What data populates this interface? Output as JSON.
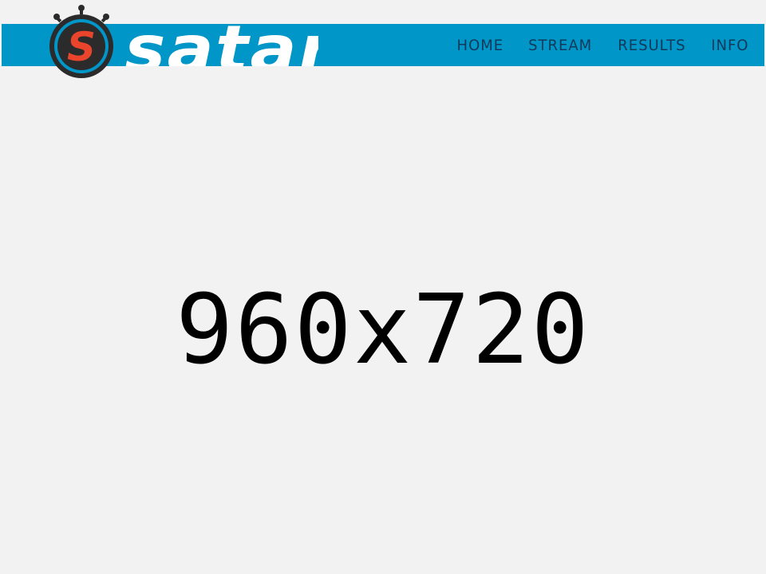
{
  "header": {
    "brand": "satar",
    "logo_letter": "S",
    "nav": [
      {
        "label": "HOME"
      },
      {
        "label": "STREAM"
      },
      {
        "label": "RESULTS"
      },
      {
        "label": "INFO"
      }
    ]
  },
  "main": {
    "placeholder_text": "960x720"
  },
  "colors": {
    "header_bar": "#0096c8",
    "nav_text": "#113a5a",
    "page_background": "#f2f2f2",
    "logo_ring": "#0096c8",
    "logo_fill": "#2b2b2b",
    "logo_letter": "#e8452c"
  },
  "icons": {
    "logo": "stopwatch-logo-icon"
  }
}
